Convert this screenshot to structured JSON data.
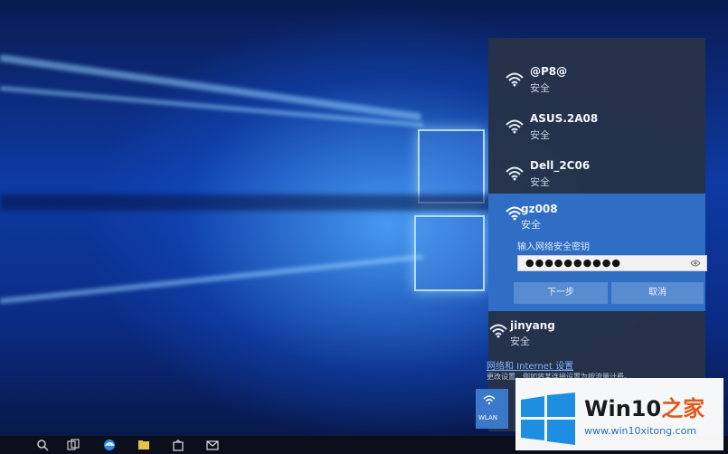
{
  "wifi_panel": {
    "networks": [
      {
        "ssid": "@P8@",
        "status": "安全"
      },
      {
        "ssid": "ASUS.2A08",
        "status": "安全"
      },
      {
        "ssid": "Dell_2C06",
        "status": "安全"
      },
      {
        "ssid": "jinyang",
        "status": "安全"
      }
    ],
    "active": {
      "ssid": "gz008",
      "status": "安全",
      "password_label": "输入网络安全密钥",
      "password_value": "●●●●●●●●●●",
      "next_label": "下一步",
      "cancel_label": "取消"
    },
    "settings_link": "网络和 Internet 设置",
    "settings_desc": "更改设置，例如将某连接设置为按流量计费。",
    "wlan_tile_label": "WLAN"
  },
  "watermark": {
    "title_prefix": "Win10",
    "title_suffix": "之家",
    "url": "www.win10xitong.com"
  },
  "colors": {
    "active_network_bg": "#2f6ec4",
    "panel_bg": "#263248",
    "watermark_accent": "#e0591b"
  }
}
